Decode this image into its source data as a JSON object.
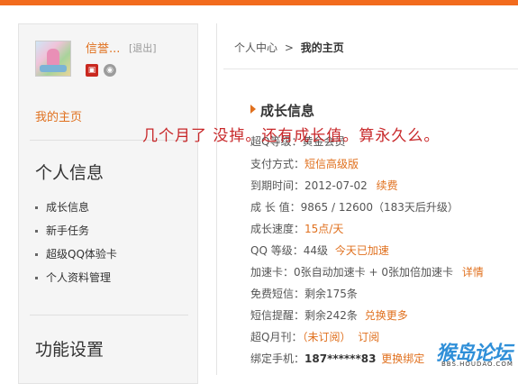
{
  "user": {
    "name": "信誉...",
    "logout": "[退出]",
    "badges": [
      "vip-badge",
      "qq-badge"
    ]
  },
  "sidebar": {
    "my_home": "我的主页",
    "section1": "个人信息",
    "items": [
      "成长信息",
      "新手任务",
      "超级QQ体验卡",
      "个人资料管理"
    ],
    "section2": "功能设置"
  },
  "breadcrumb": {
    "root": "个人中心",
    "sep": ">",
    "current": "我的主页"
  },
  "growth": {
    "title": "成长信息"
  },
  "overlay_text": "几个月了  没掉。还有成长值。算永久么。",
  "rows": {
    "r1": {
      "label": "超Q等级：",
      "value": "黄金会员"
    },
    "r2": {
      "label": "支付方式：",
      "value": "短信高级版"
    },
    "r3": {
      "label": "到期时间：",
      "value": "2012-07-02",
      "link": "续费"
    },
    "r4": {
      "label": "成 长 值：",
      "value": "9865 / 12600（183天后升级）"
    },
    "r5": {
      "label": "成长速度：",
      "value": "15点/天"
    },
    "r6": {
      "label": "QQ 等级：",
      "value": "44级",
      "link": "今天已加速"
    },
    "r7": {
      "label": "加速卡：",
      "value": "0张自动加速卡 + 0张加倍加速卡",
      "link": "详情"
    },
    "r8": {
      "label": "免费短信：",
      "value": "剩余175条"
    },
    "r9": {
      "label": "短信提醒：",
      "value": "剩余242条",
      "link": "兑换更多"
    },
    "r10": {
      "label": "超Q月刊：",
      "value": "（未订阅）",
      "link": "订阅"
    },
    "r11": {
      "label": "绑定手机：",
      "value": "187******83",
      "link": "更换绑定"
    }
  },
  "watermark": {
    "text": "猴岛论坛",
    "sub": "BBS.HOUDAO.COM"
  },
  "colors": {
    "accent": "#e0701e",
    "topbar": "#f26b1d",
    "overlay": "#c8282a"
  }
}
